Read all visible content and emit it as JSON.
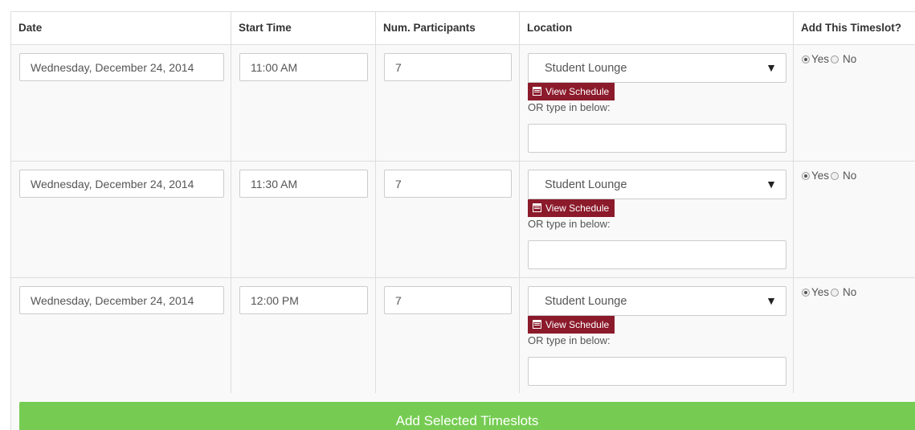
{
  "table": {
    "headers": {
      "date": "Date",
      "start_time": "Start Time",
      "participants": "Num. Participants",
      "location": "Location",
      "add": "Add This Timeslot?"
    },
    "rows": [
      {
        "date": "Wednesday, December 24, 2014",
        "start_time": "11:00 AM",
        "participants": "7",
        "location": "Student Lounge",
        "schedule_label": "View Schedule",
        "or_label": "OR type in below:",
        "custom_location": "",
        "yes_label": "Yes",
        "no_label": "No",
        "selected": "yes"
      },
      {
        "date": "Wednesday, December 24, 2014",
        "start_time": "11:30 AM",
        "participants": "7",
        "location": "Student Lounge",
        "schedule_label": "View Schedule",
        "or_label": "OR type in below:",
        "custom_location": "",
        "yes_label": "Yes",
        "no_label": "No",
        "selected": "yes"
      },
      {
        "date": "Wednesday, December 24, 2014",
        "start_time": "12:00 PM",
        "participants": "7",
        "location": "Student Lounge",
        "schedule_label": "View Schedule",
        "or_label": "OR type in below:",
        "custom_location": "",
        "yes_label": "Yes",
        "no_label": "No",
        "selected": "yes"
      }
    ]
  },
  "icons": {
    "schedule": "calendar-icon",
    "dropdown": "caret-down-icon"
  },
  "colors": {
    "schedule_button": "#8b1a2b",
    "submit_button": "#76cc52",
    "row_background": "#f9f9f9",
    "border": "#dddddd"
  },
  "actions": {
    "submit_label": "Add Selected Timeslots"
  }
}
